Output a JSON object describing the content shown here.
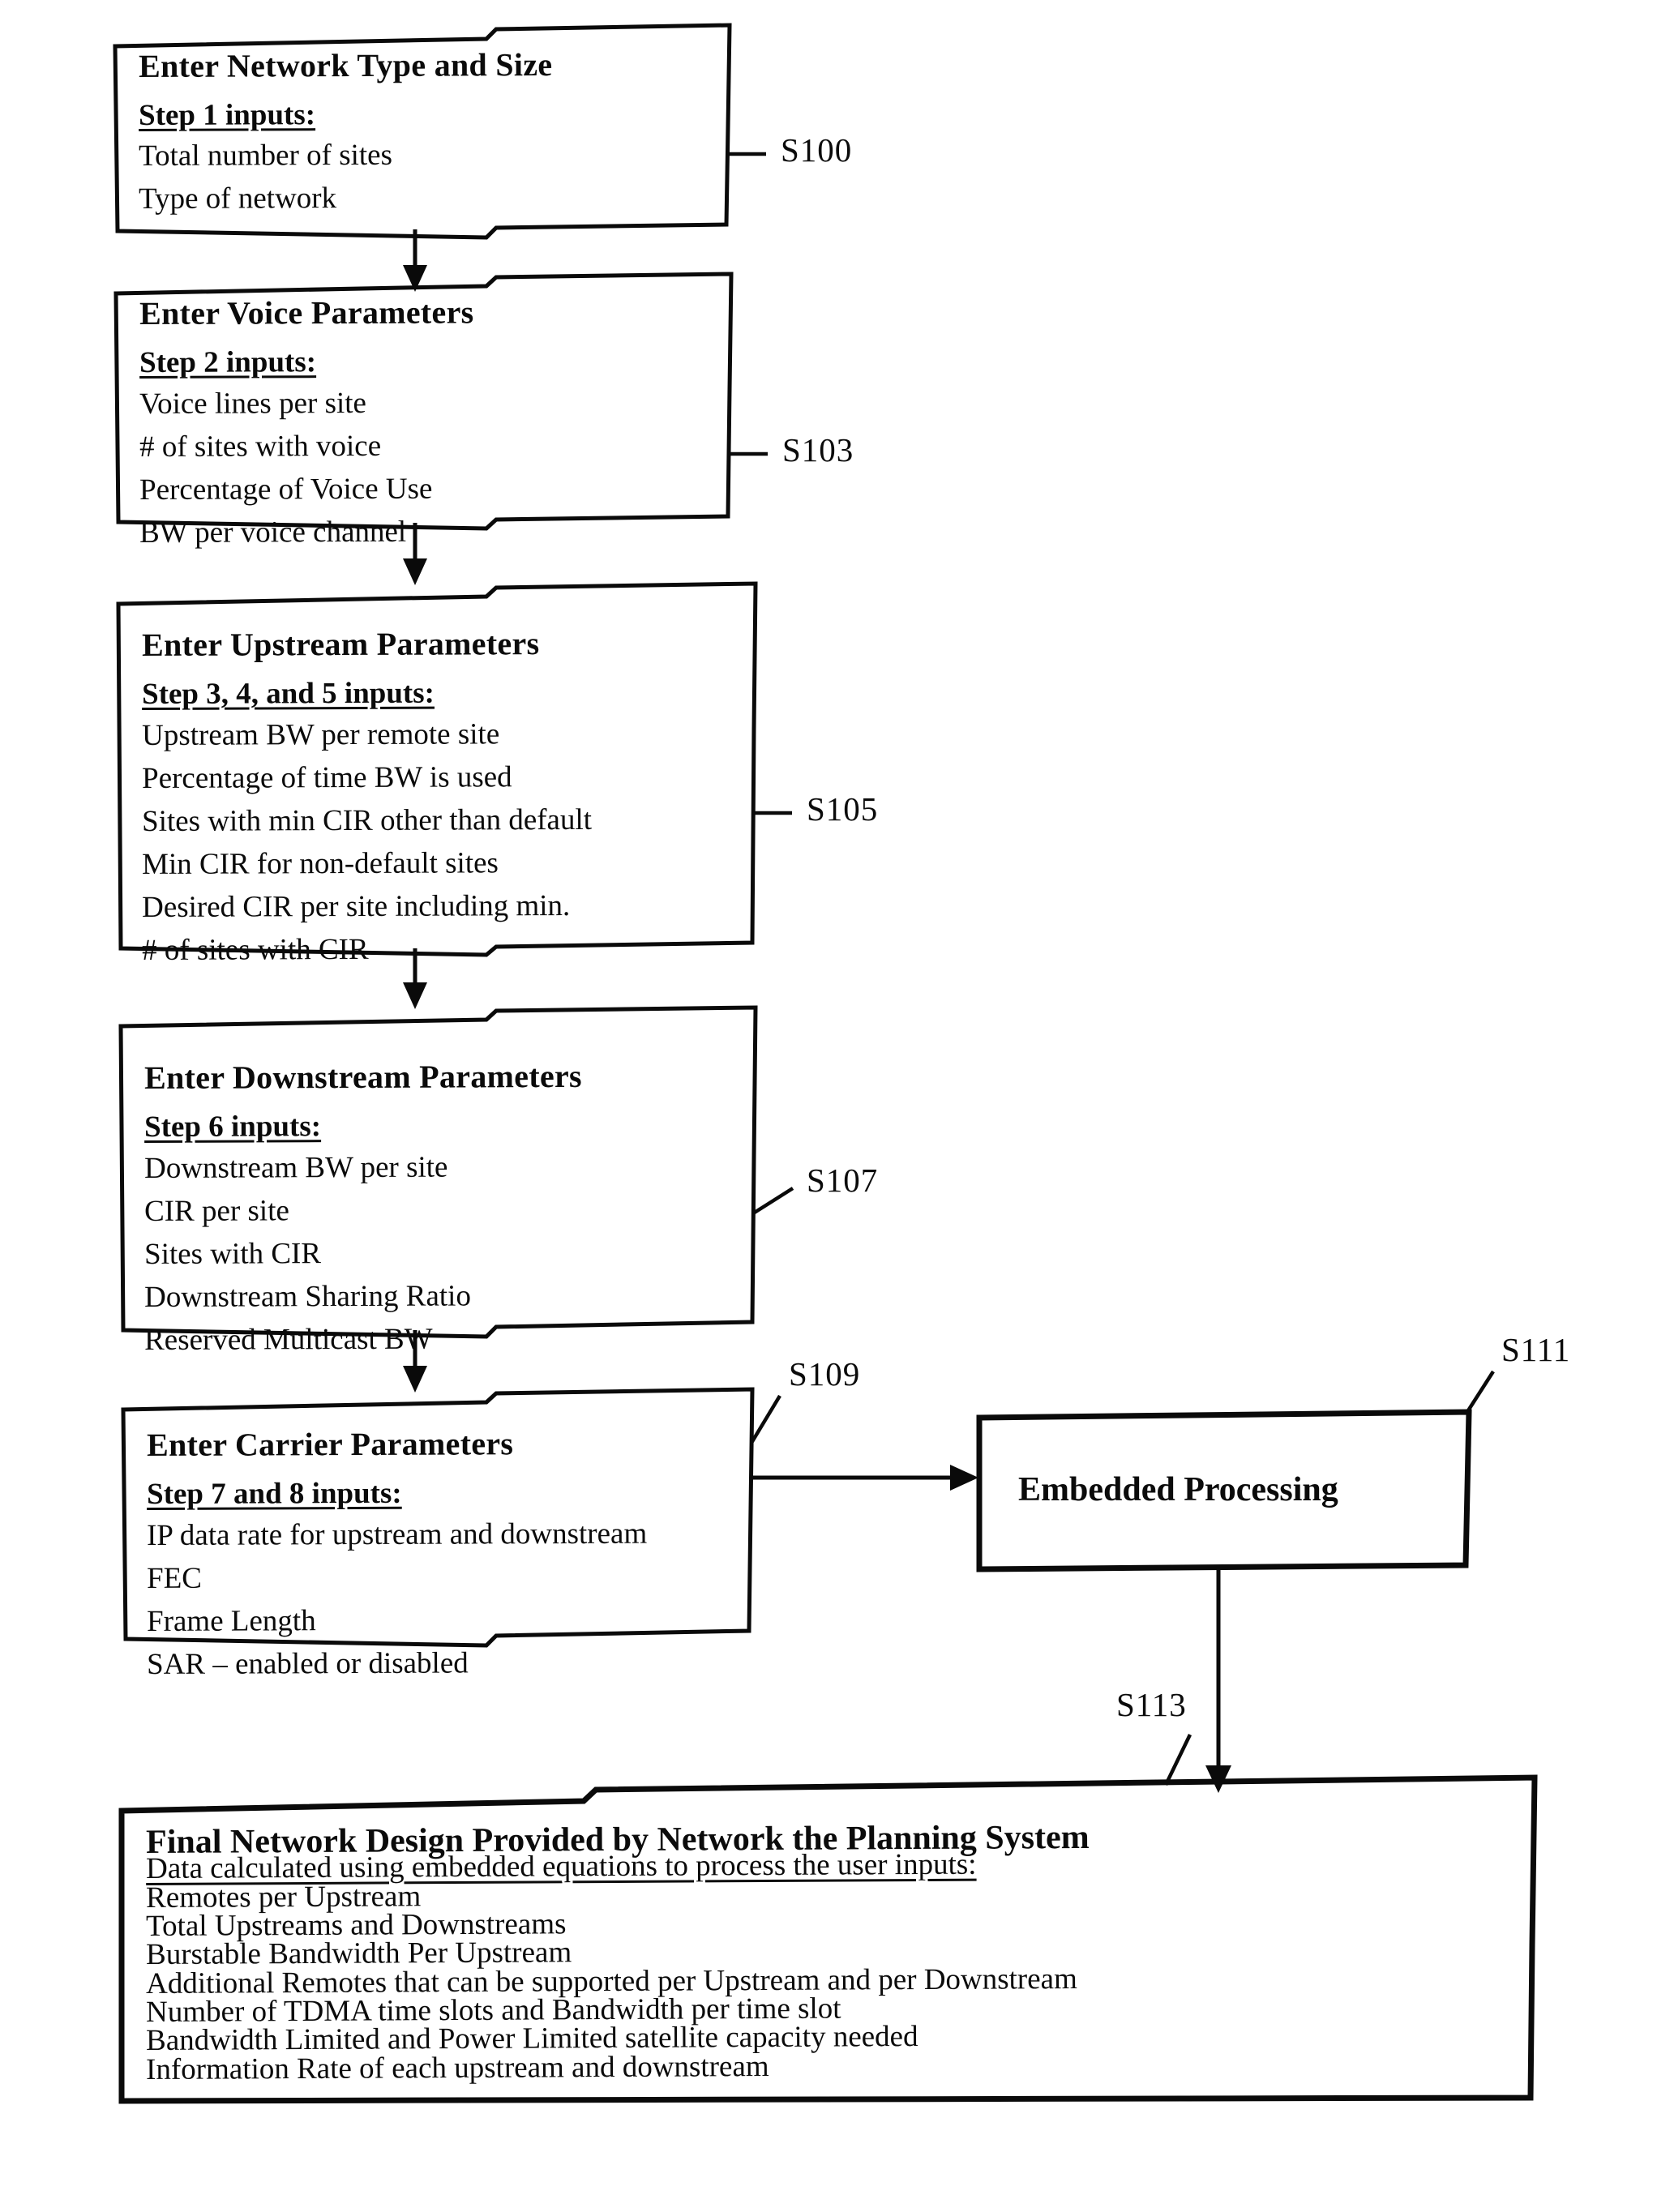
{
  "figure": {
    "kind": "patent-flowchart",
    "ink_color": "#0a0a0a",
    "background_color": "#ffffff"
  },
  "nodes": [
    {
      "id": "s100",
      "ref": "S100",
      "title": "Enter Network Type and Size",
      "subhead": "Step 1 inputs:",
      "items": [
        "Total number of sites",
        "Type of network"
      ]
    },
    {
      "id": "s103",
      "ref": "S103",
      "title": "Enter Voice Parameters",
      "subhead": "Step 2 inputs:",
      "items": [
        "Voice lines per site",
        "# of sites with voice",
        "Percentage of Voice Use",
        "BW per voice channel"
      ]
    },
    {
      "id": "s105",
      "ref": "S105",
      "title": "Enter Upstream Parameters",
      "subhead": "Step 3, 4, and 5 inputs:",
      "items": [
        "Upstream BW per remote site",
        "Percentage of time BW is used",
        "Sites with min CIR other than default",
        "Min CIR for non-default sites",
        "Desired CIR per site including min.",
        "# of sites with CIR"
      ]
    },
    {
      "id": "s107",
      "ref": "S107",
      "title": "Enter Downstream Parameters",
      "subhead": "Step 6 inputs:",
      "items": [
        "Downstream BW per site",
        "CIR per site",
        "Sites with CIR",
        "Downstream Sharing Ratio",
        "Reserved Multicast BW"
      ]
    },
    {
      "id": "s109",
      "ref": "S109",
      "title": "Enter Carrier Parameters",
      "subhead": "Step 7 and 8 inputs:",
      "items": [
        "IP data rate for upstream and downstream",
        "FEC",
        "Frame Length",
        "SAR – enabled or disabled"
      ]
    },
    {
      "id": "s111",
      "ref": "S111",
      "title": "Embedded Processing",
      "subhead": "",
      "items": []
    },
    {
      "id": "s113",
      "ref": "S113",
      "title": "Final Network Design Provided by Network the Planning System",
      "subhead": "Data calculated using embedded equations to process the user inputs:",
      "items": [
        "Remotes per Upstream",
        "Total Upstreams and Downstreams",
        "Burstable Bandwidth Per Upstream",
        "Additional Remotes that can be supported per Upstream and per Downstream",
        "Number of TDMA time slots and Bandwidth per time slot",
        "Bandwidth Limited and Power Limited satellite capacity needed",
        "Information Rate of each upstream and downstream"
      ]
    }
  ],
  "connectors": [
    {
      "from": "s100",
      "to": "s103",
      "direction": "down"
    },
    {
      "from": "s103",
      "to": "s105",
      "direction": "down"
    },
    {
      "from": "s105",
      "to": "s107",
      "direction": "down"
    },
    {
      "from": "s107",
      "to": "s109",
      "direction": "down"
    },
    {
      "from": "s109",
      "to": "s111",
      "direction": "right"
    },
    {
      "from": "s111",
      "to": "s113",
      "direction": "down"
    }
  ]
}
